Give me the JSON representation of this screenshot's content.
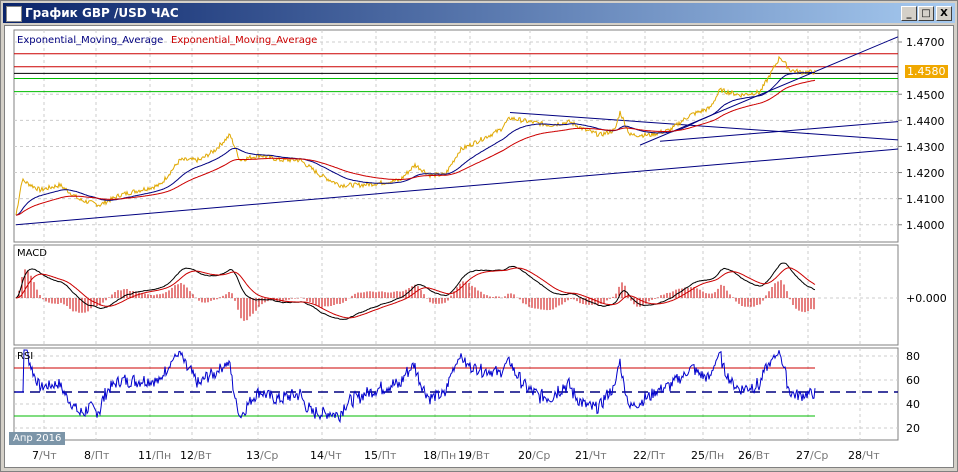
{
  "window": {
    "title": "График GBP /USD  ЧАС",
    "minimize": "_",
    "maximize": "□",
    "close": "X"
  },
  "legend": {
    "ema_fast": "Exponential_Moving_Average",
    "ema_slow": "Exponential_Moving_Average"
  },
  "colors": {
    "price": "#e0a800",
    "ema_fast": "#000080",
    "ema_slow": "#cc0000",
    "resistance": "#cc0000",
    "support": "#00bb00",
    "trend": "#000080",
    "current_price_bg": "#f0a800"
  },
  "price_axis": {
    "ticks": [
      "1.4700",
      "1.4500",
      "1.4400",
      "1.4300",
      "1.4200",
      "1.4100",
      "1.4000"
    ],
    "current_price": "1.4580"
  },
  "macd": {
    "label": "MACD",
    "zero_label": "+0.000"
  },
  "rsi": {
    "label": "RSI",
    "ticks": [
      "80",
      "60",
      "40",
      "20"
    ],
    "levels": {
      "high": 70,
      "mid": 50,
      "low": 30
    }
  },
  "month_badge": "Апр 2016",
  "dates": [
    [
      "7",
      "/Чт"
    ],
    [
      "8",
      "/Пт"
    ],
    [
      "11",
      "/Пн"
    ],
    [
      "12",
      "/Вт"
    ],
    [
      "13",
      "/Ср"
    ],
    [
      "14",
      "/Чт"
    ],
    [
      "15",
      "/Пт"
    ],
    [
      "18",
      "/Пн"
    ],
    [
      "19",
      "/Вт"
    ],
    [
      "20",
      "/Ср"
    ],
    [
      "21",
      "/Чт"
    ],
    [
      "22",
      "/Пт"
    ],
    [
      "25",
      "/Пн"
    ],
    [
      "26",
      "/Вт"
    ],
    [
      "27",
      "/Ср"
    ],
    [
      "28",
      "/Чт"
    ]
  ],
  "chart_data": {
    "type": "line",
    "title": "GBP/USD hourly",
    "ylim": [
      1.397,
      1.473
    ],
    "x_unit": "bar index",
    "price": [
      [
        0,
        1.4037
      ],
      [
        6,
        1.4171
      ],
      [
        24,
        1.4133
      ],
      [
        44,
        1.4152
      ],
      [
        64,
        1.4095
      ],
      [
        84,
        1.4076
      ],
      [
        104,
        1.4114
      ],
      [
        124,
        1.4133
      ],
      [
        144,
        1.4152
      ],
      [
        164,
        1.4248
      ],
      [
        184,
        1.4248
      ],
      [
        199,
        1.4286
      ],
      [
        214,
        1.4344
      ],
      [
        224,
        1.4248
      ],
      [
        244,
        1.4267
      ],
      [
        264,
        1.4248
      ],
      [
        284,
        1.4248
      ],
      [
        304,
        1.4191
      ],
      [
        324,
        1.4152
      ],
      [
        344,
        1.4152
      ],
      [
        364,
        1.416
      ],
      [
        384,
        1.4171
      ],
      [
        399,
        1.4229
      ],
      [
        414,
        1.4191
      ],
      [
        429,
        1.4191
      ],
      [
        444,
        1.4286
      ],
      [
        464,
        1.4325
      ],
      [
        484,
        1.4363
      ],
      [
        494,
        1.4409
      ],
      [
        514,
        1.4394
      ],
      [
        534,
        1.4382
      ],
      [
        554,
        1.4394
      ],
      [
        569,
        1.4363
      ],
      [
        584,
        1.4344
      ],
      [
        599,
        1.4363
      ],
      [
        604,
        1.4432
      ],
      [
        614,
        1.4344
      ],
      [
        634,
        1.4344
      ],
      [
        654,
        1.4363
      ],
      [
        674,
        1.442
      ],
      [
        694,
        1.4447
      ],
      [
        704,
        1.4516
      ],
      [
        724,
        1.4497
      ],
      [
        744,
        1.4508
      ],
      [
        754,
        1.4574
      ],
      [
        764,
        1.4643
      ],
      [
        774,
        1.4593
      ],
      [
        784,
        1.4585
      ],
      [
        799,
        1.4585
      ]
    ],
    "horizontal_levels": [
      {
        "value": 1.4655,
        "kind": "resistance"
      },
      {
        "value": 1.4605,
        "kind": "resistance"
      },
      {
        "value": 1.458,
        "kind": "current"
      },
      {
        "value": 1.456,
        "kind": "support"
      },
      {
        "value": 1.451,
        "kind": "support"
      }
    ],
    "trendlines": [
      [
        [
          0,
          1.4
        ],
        [
          882,
          1.429
        ]
      ],
      [
        [
          494,
          1.443
        ],
        [
          882,
          1.4325
        ]
      ],
      [
        [
          644,
          1.432
        ],
        [
          882,
          1.4395
        ]
      ],
      [
        [
          624,
          1.4305
        ],
        [
          882,
          1.472
        ]
      ]
    ],
    "macd_zero": 0.0
  }
}
